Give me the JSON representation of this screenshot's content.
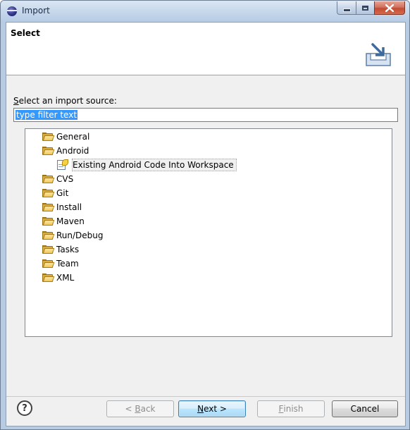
{
  "window": {
    "title": "Import"
  },
  "header": {
    "title": "Select"
  },
  "source": {
    "label_mnemonic": "S",
    "label_rest": "elect an import source:",
    "filter_value": "type filter text"
  },
  "tree": [
    {
      "label": "General",
      "icon": "folder-icon",
      "level": 0
    },
    {
      "label": "Android",
      "icon": "folder-icon",
      "level": 0
    },
    {
      "label": "Existing Android Code Into Workspace",
      "icon": "wizard-icon",
      "level": 1,
      "selected": true
    },
    {
      "label": "CVS",
      "icon": "folder-icon",
      "level": 0
    },
    {
      "label": "Git",
      "icon": "folder-icon",
      "level": 0
    },
    {
      "label": "Install",
      "icon": "folder-icon",
      "level": 0
    },
    {
      "label": "Maven",
      "icon": "folder-icon",
      "level": 0
    },
    {
      "label": "Run/Debug",
      "icon": "folder-icon",
      "level": 0
    },
    {
      "label": "Tasks",
      "icon": "folder-icon",
      "level": 0
    },
    {
      "label": "Team",
      "icon": "folder-icon",
      "level": 0
    },
    {
      "label": "XML",
      "icon": "folder-icon",
      "level": 0
    }
  ],
  "footer": {
    "help": "?",
    "back_prefix": "< ",
    "back_mnemonic": "B",
    "back_rest": "ack",
    "next_prefix": "",
    "next_mnemonic": "N",
    "next_rest": "ext >",
    "finish_mnemonic": "F",
    "finish_rest": "inish",
    "cancel": "Cancel"
  },
  "colors": {
    "selection": "#3399ff",
    "title_bar": "#c7d8ec",
    "close_button": "#c24b33"
  }
}
